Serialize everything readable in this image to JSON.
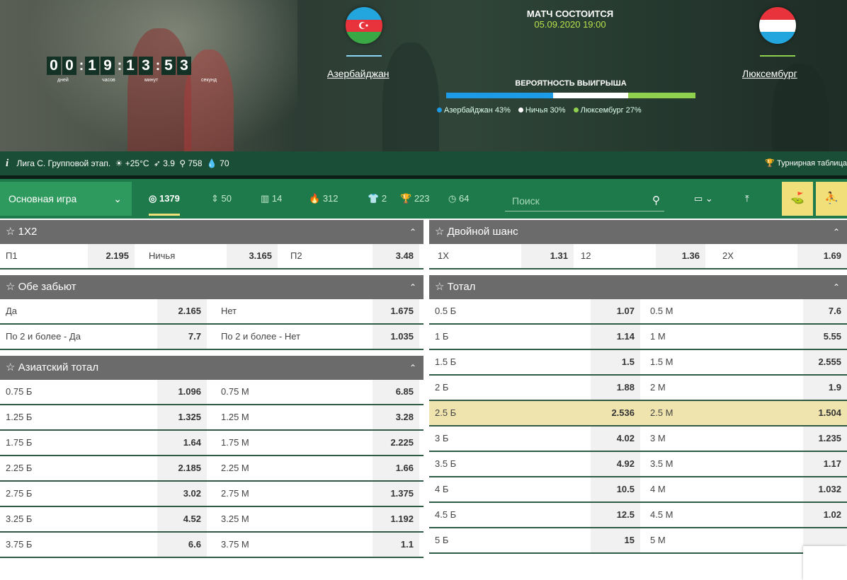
{
  "countdown": {
    "digits": [
      "0",
      "0",
      "1",
      "9",
      "1",
      "3",
      "5",
      "3"
    ],
    "units": [
      "дней",
      "часов",
      "минут",
      "секунд"
    ]
  },
  "teams": {
    "home": {
      "name": "Азербайджан"
    },
    "away": {
      "name": "Люксембург"
    }
  },
  "match": {
    "status": "МАТЧ СОСТОИТСЯ",
    "datetime": "05.09.2020 19:00"
  },
  "probability": {
    "title": "ВЕРОЯТНОСТЬ ВЫИГРЫША",
    "home_pct": 43,
    "draw_pct": 30,
    "away_pct": 27,
    "legend_home": "Азербайджан 43%",
    "legend_draw": "Ничья 30%",
    "legend_away": "Люксембург 27%",
    "colors": {
      "home": "#1e9be6",
      "draw": "#ffffff",
      "away": "#8fd14f"
    }
  },
  "info": {
    "league": "Лига С. Групповой этап.",
    "temp": "+25°C",
    "wind": "3.9",
    "pressure": "758",
    "humidity": "70",
    "standings": "Турнирная таблица"
  },
  "toolbar": {
    "main": "Основная игра",
    "counts": [
      "1379",
      "50",
      "14",
      "312",
      "2",
      "223",
      "64"
    ],
    "search_placeholder": "Поиск"
  },
  "left": {
    "s1": {
      "title": "1X2",
      "rows": [
        [
          "П1",
          "2.195",
          "Ничья",
          "3.165",
          "П2",
          "3.48"
        ]
      ]
    },
    "s2": {
      "title": "Обе забьют",
      "rows": [
        [
          "Да",
          "2.165",
          "Нет",
          "1.675"
        ],
        [
          "По 2 и более - Да",
          "7.7",
          "По 2 и более - Нет",
          "1.035"
        ]
      ]
    },
    "s3": {
      "title": "Азиатский тотал",
      "rows": [
        [
          "0.75 Б",
          "1.096",
          "0.75 М",
          "6.85"
        ],
        [
          "1.25 Б",
          "1.325",
          "1.25 М",
          "3.28"
        ],
        [
          "1.75 Б",
          "1.64",
          "1.75 М",
          "2.225"
        ],
        [
          "2.25 Б",
          "2.185",
          "2.25 М",
          "1.66"
        ],
        [
          "2.75 Б",
          "3.02",
          "2.75 М",
          "1.375"
        ],
        [
          "3.25 Б",
          "4.52",
          "3.25 М",
          "1.192"
        ],
        [
          "3.75 Б",
          "6.6",
          "3.75 М",
          "1.1"
        ]
      ]
    }
  },
  "right": {
    "s1": {
      "title": "Двойной шанс",
      "rows": [
        [
          "1X",
          "1.31",
          "12",
          "1.36",
          "2X",
          "1.69"
        ]
      ]
    },
    "s2": {
      "title": "Тотал",
      "rows": [
        [
          "0.5 Б",
          "1.07",
          "0.5 М",
          "7.6"
        ],
        [
          "1 Б",
          "1.14",
          "1 М",
          "5.55"
        ],
        [
          "1.5 Б",
          "1.5",
          "1.5 М",
          "2.555"
        ],
        [
          "2 Б",
          "1.88",
          "2 М",
          "1.9"
        ],
        [
          "2.5 Б",
          "2.536",
          "2.5 М",
          "1.504"
        ],
        [
          "3 Б",
          "4.02",
          "3 М",
          "1.235"
        ],
        [
          "3.5 Б",
          "4.92",
          "3.5 М",
          "1.17"
        ],
        [
          "4 Б",
          "10.5",
          "4 М",
          "1.032"
        ],
        [
          "4.5 Б",
          "12.5",
          "4.5 М",
          "1.02"
        ],
        [
          "5 Б",
          "15",
          "5 М",
          ""
        ]
      ]
    }
  }
}
